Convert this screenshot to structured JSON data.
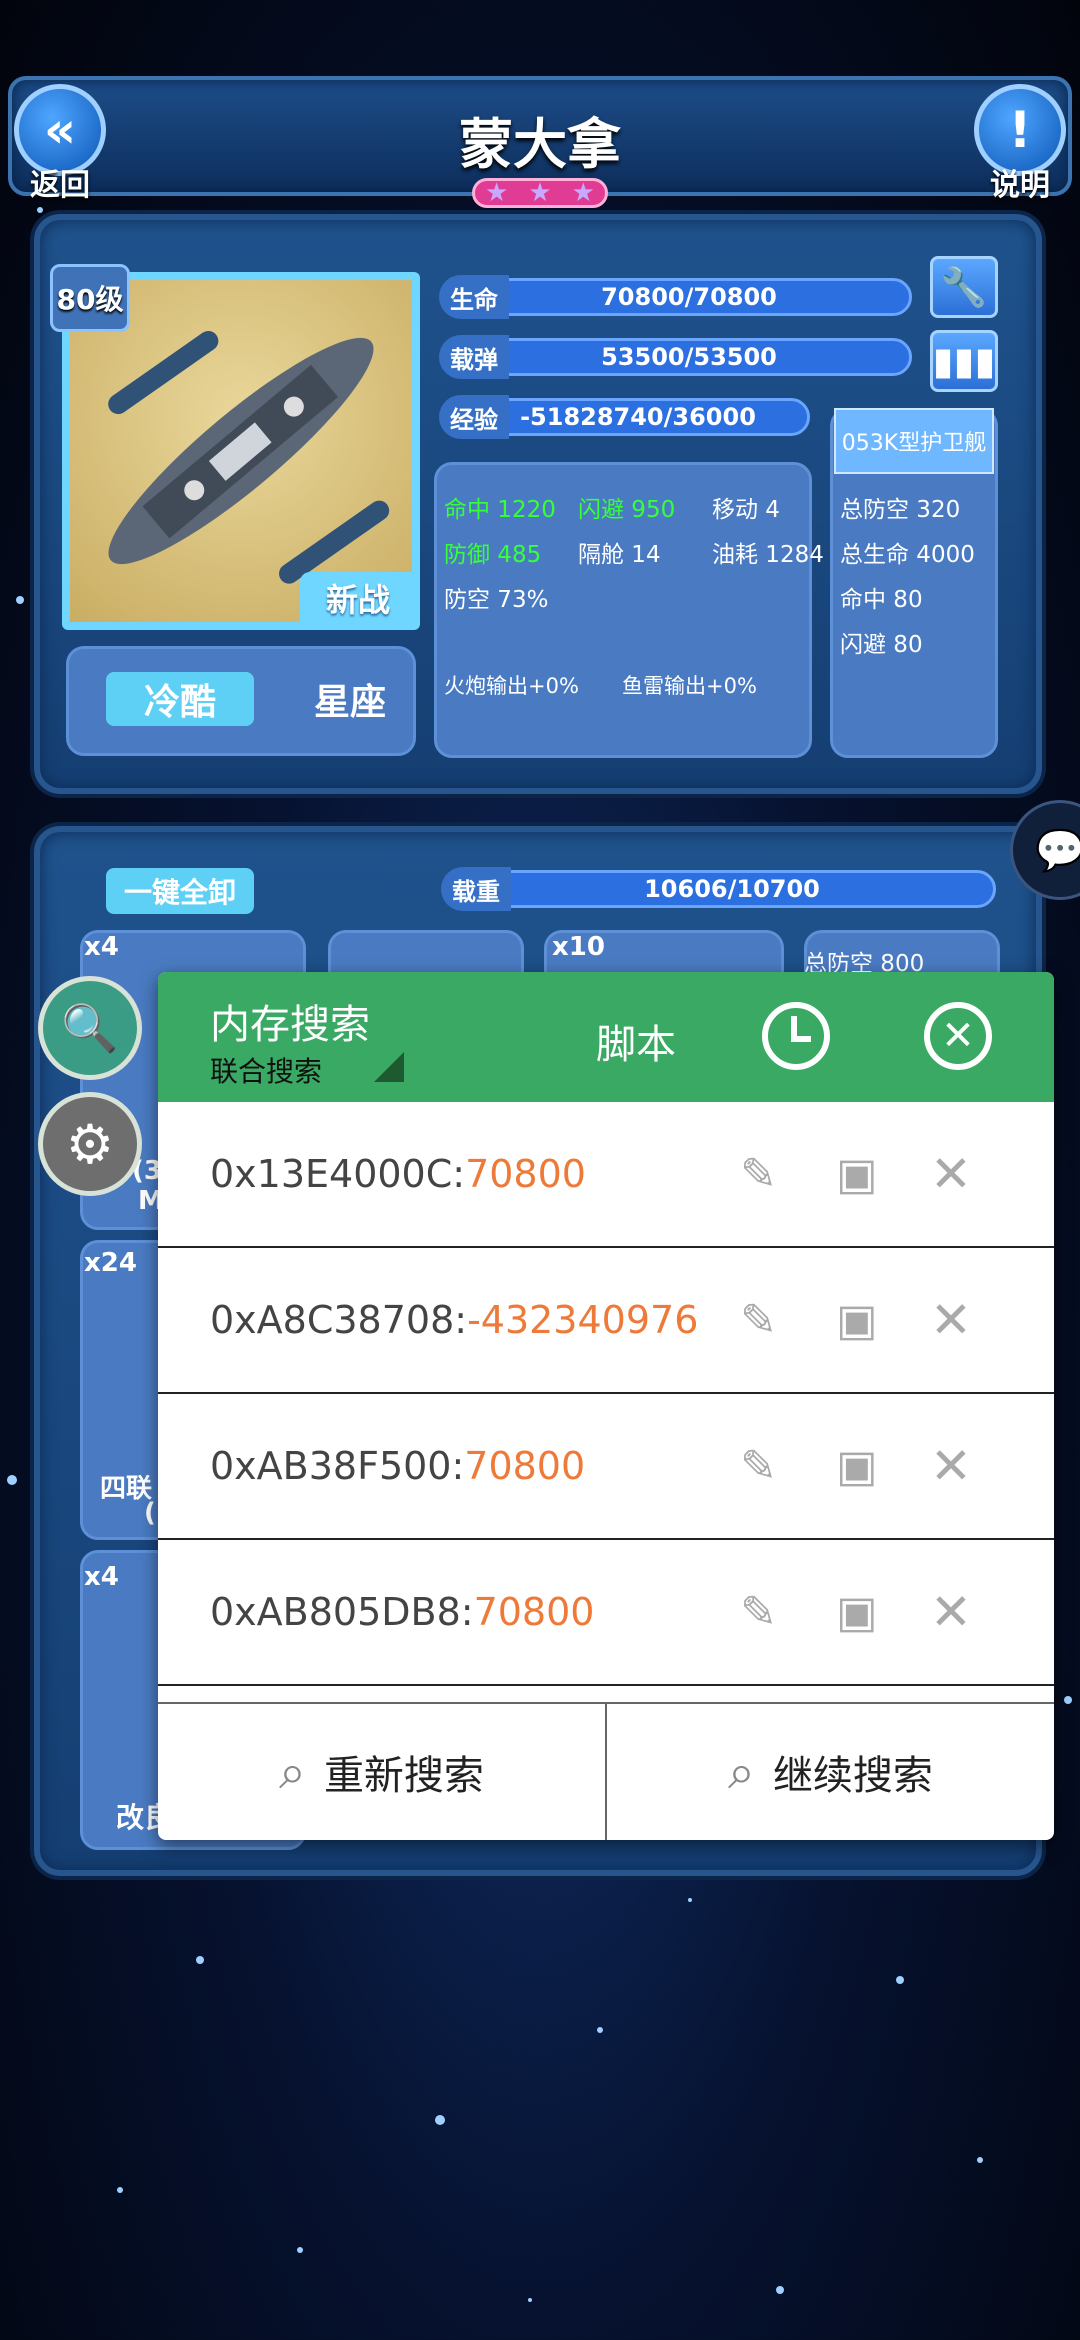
{
  "header": {
    "back_label": "返回",
    "title": "蒙大拿",
    "help_label": "说明",
    "stars": [
      "★",
      "★",
      "★"
    ]
  },
  "ship": {
    "level": "80级",
    "tag": "新战",
    "tabs": [
      "冷酷",
      "星座"
    ],
    "bars": [
      {
        "label": "生命",
        "value": "70800/70800"
      },
      {
        "label": "载弹",
        "value": "53500/53500"
      },
      {
        "label": "经验",
        "value": "-51828740/36000"
      }
    ],
    "stats": {
      "hit": "命中 1220",
      "evade": "闪避 950",
      "move": "移动 4",
      "defense": "防御 485",
      "bulkhead": "隔舱 14",
      "fuel": "油耗 1284",
      "aa": "防空 73%",
      "gun_output": "火炮输出+0%",
      "torpedo_output": "鱼雷输出+0%"
    },
    "escort": {
      "title": "053K型护卫舰",
      "lines": [
        "总防空 320",
        "总生命 4000",
        "命中 80",
        "闪避 80"
      ]
    }
  },
  "equip": {
    "unload_all": "一键全卸",
    "load_label": "载重",
    "load_value": "10606/10700",
    "badges": [
      "x4",
      "x10",
      "x24",
      "x4"
    ],
    "partial_text": {
      "total_aa": "总防空 800",
      "side1": "(3",
      "side2": "M",
      "quad": "四联",
      "paren": "(",
      "improve": "改良"
    }
  },
  "memory_search": {
    "title": "内存搜索",
    "subtitle": "联合搜索",
    "script_label": "脚本",
    "results": [
      {
        "address": "0x13E4000C:",
        "value": "70800"
      },
      {
        "address": "0xA8C38708:",
        "value": "-432340976"
      },
      {
        "address": "0xAB38F500:",
        "value": "70800"
      },
      {
        "address": "0xAB805DB8:",
        "value": "70800"
      }
    ],
    "research_label": "重新搜索",
    "continue_label": "继续搜索"
  },
  "colors": {
    "overlay_header": "#3aa964",
    "value_orange": "#ee7a3a",
    "panel_blue": "#4a7bc2"
  }
}
